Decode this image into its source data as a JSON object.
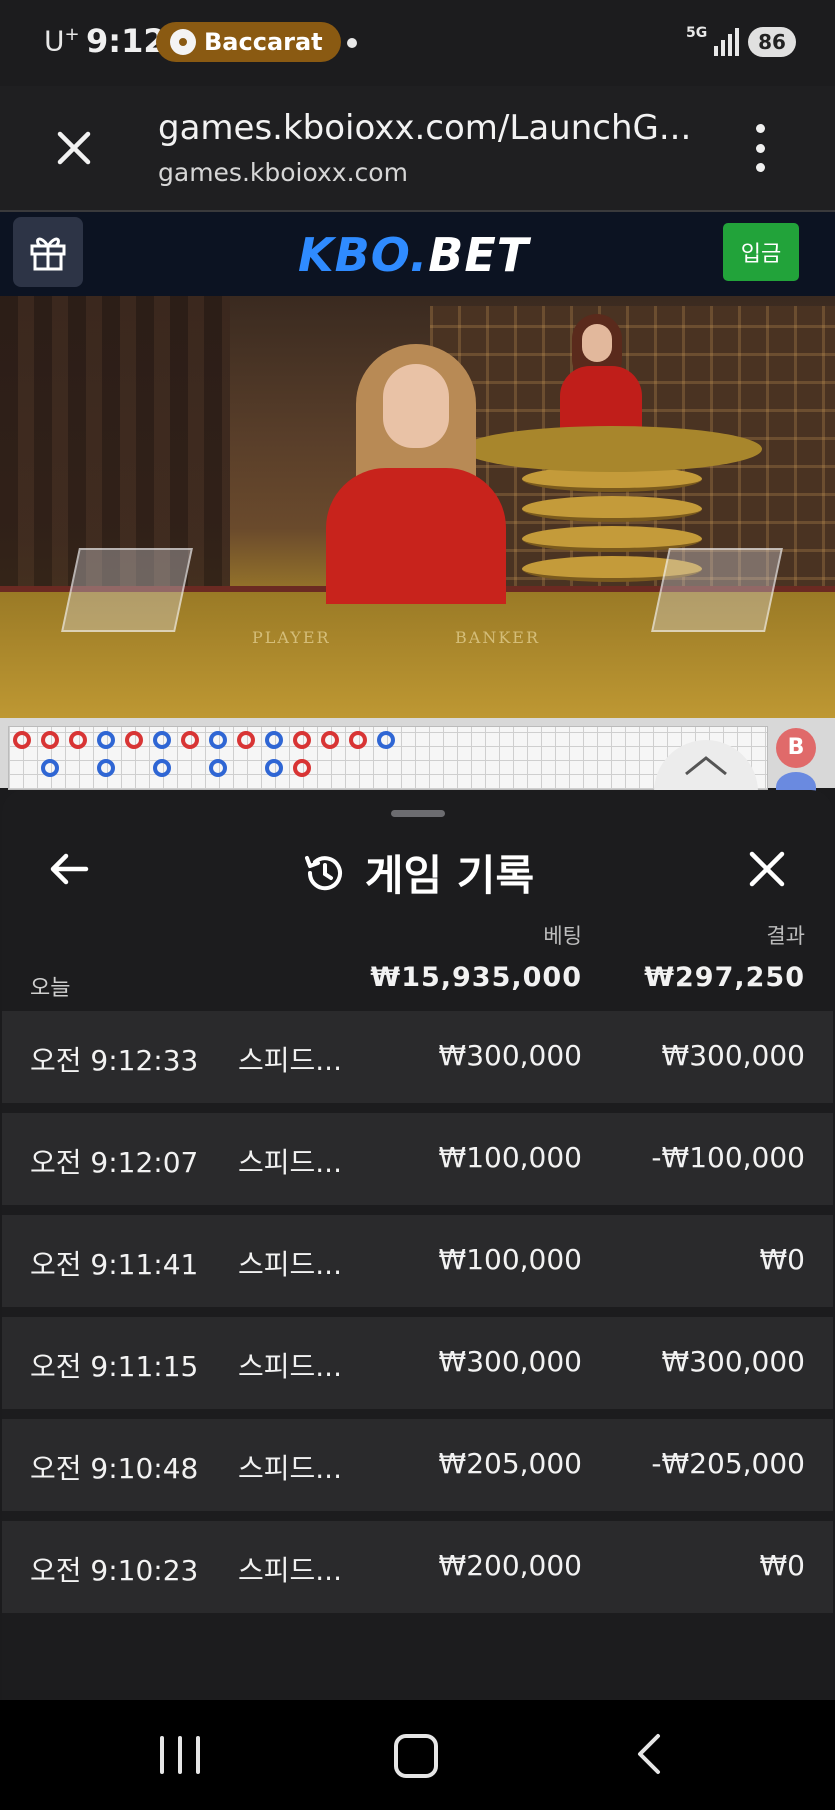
{
  "status_bar": {
    "carrier": "U",
    "carrier_sup": "+",
    "time": "9:12",
    "app_name": "Baccarat",
    "network": "5G",
    "battery": "86"
  },
  "browser": {
    "url_title": "games.kboioxx.com/LaunchG...",
    "domain": "games.kboioxx.com"
  },
  "site_header": {
    "brand_part1": "KBO.",
    "brand_part2": "BET",
    "deposit_label": "입금"
  },
  "video": {
    "player_label": "PLAYER",
    "banker_label": "BANKER"
  },
  "scoreboard": {
    "badge_label": "B"
  },
  "history": {
    "title": "게임 기록",
    "col_bet": "베팅",
    "col_result": "결과",
    "today_label": "오늘",
    "total_bet": "₩15,935,000",
    "total_result": "₩297,250",
    "rows": [
      {
        "time": "오전 9:12:33",
        "game": "스피드...",
        "bet": "₩300,000",
        "result": "₩300,000"
      },
      {
        "time": "오전 9:12:07",
        "game": "스피드...",
        "bet": "₩100,000",
        "result": "-₩100,000"
      },
      {
        "time": "오전 9:11:41",
        "game": "스피드...",
        "bet": "₩100,000",
        "result": "₩0"
      },
      {
        "time": "오전 9:11:15",
        "game": "스피드...",
        "bet": "₩300,000",
        "result": "₩300,000"
      },
      {
        "time": "오전 9:10:48",
        "game": "스피드...",
        "bet": "₩205,000",
        "result": "-₩205,000"
      },
      {
        "time": "오전 9:10:23",
        "game": "스피드...",
        "bet": "₩200,000",
        "result": "₩0"
      }
    ]
  },
  "icons": {
    "back": "arrow-left-icon",
    "history": "history-icon",
    "close": "close-icon",
    "gift": "gift-icon",
    "menu": "more-vert-icon"
  },
  "colors": {
    "brand_blue": "#2f8bff",
    "deposit_green": "#22a33a",
    "app_pill": "#8a5a12"
  }
}
